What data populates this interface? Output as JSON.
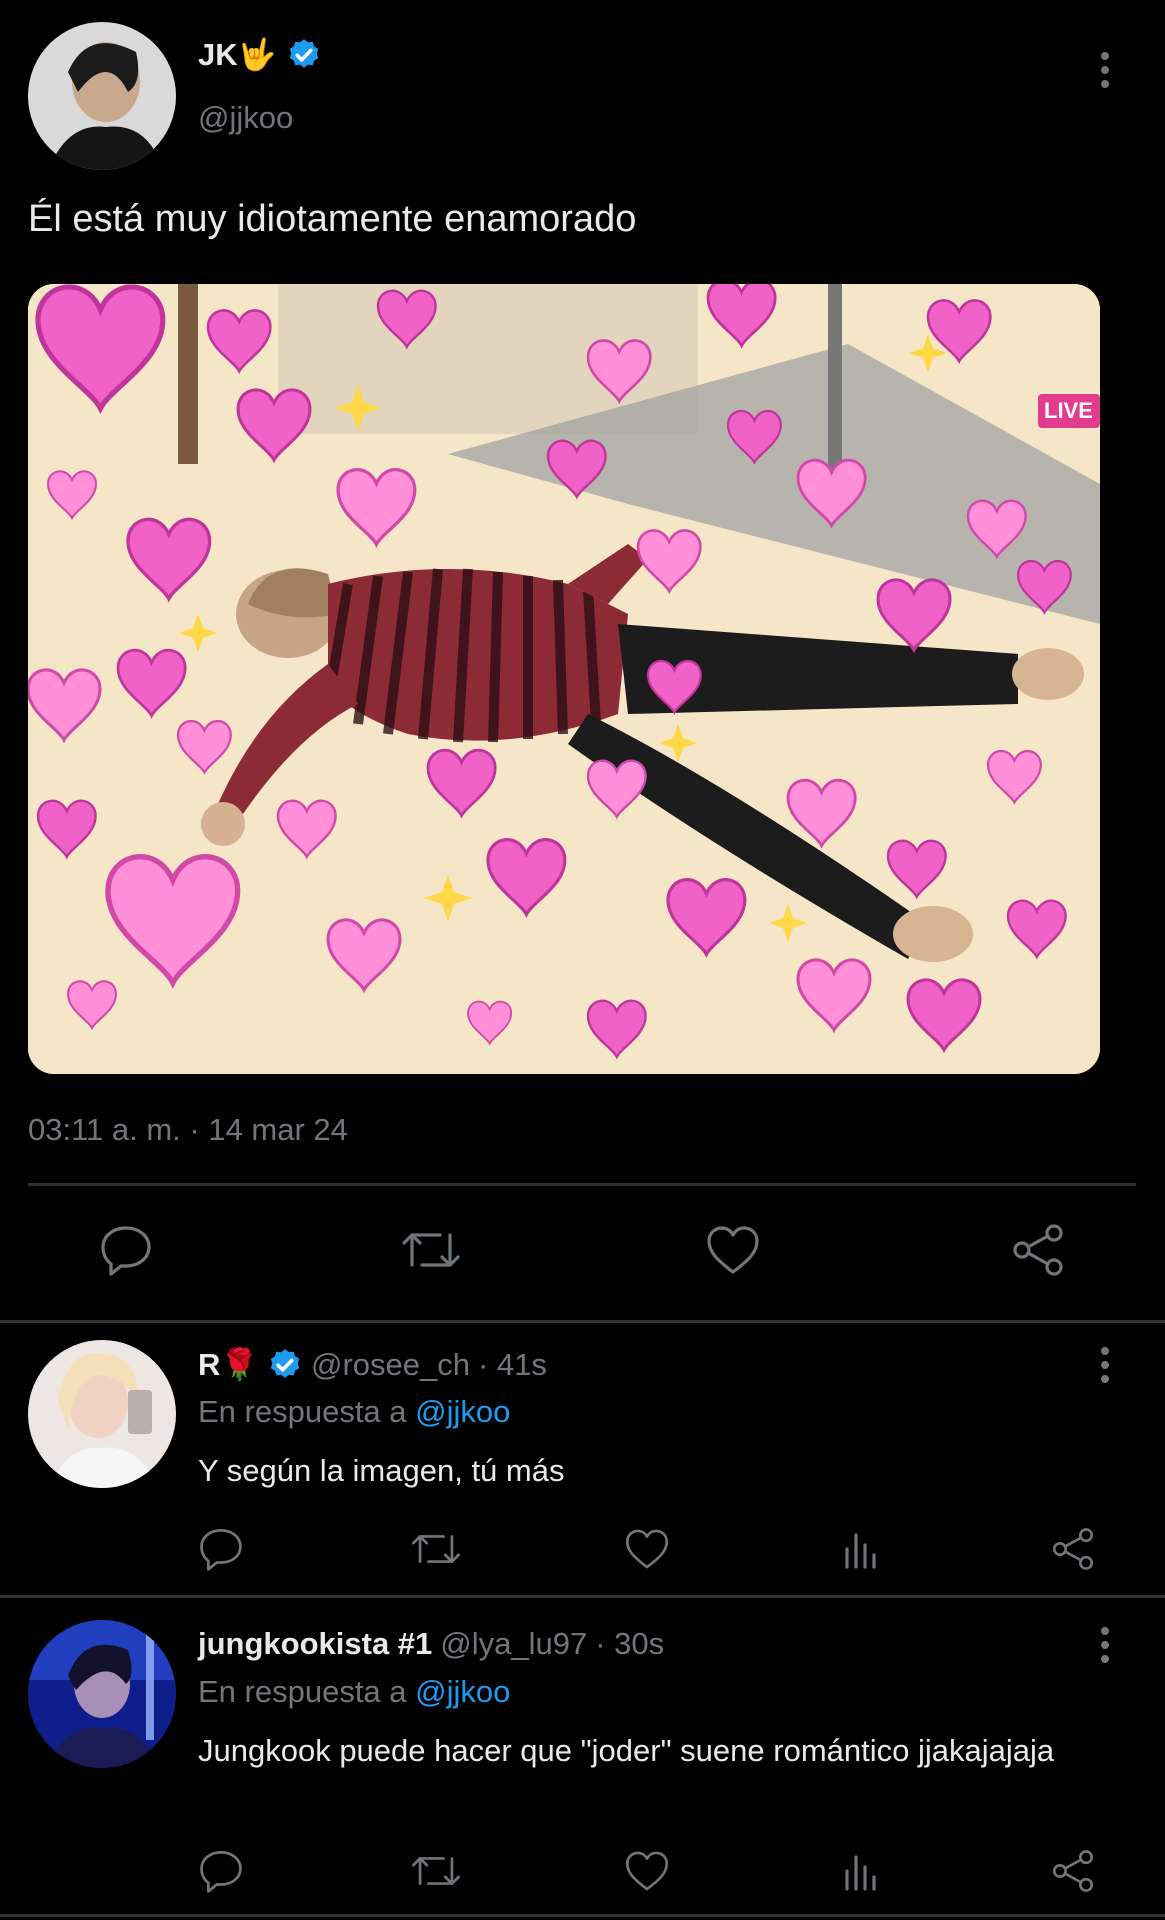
{
  "main_tweet": {
    "display_name": "JK🤟",
    "handle": "@jjkoo",
    "text": "Él está muy idiotamente enamorado",
    "timestamp": "03:11 a. m. · 14 mar 24",
    "image_caption_text": "LIVE"
  },
  "replies": [
    {
      "display_name": "R🌹",
      "handle": "@rosee_ch",
      "time": "· 41s",
      "reply_to_label": "En respuesta a",
      "reply_to_handle": "@jjkoo",
      "text": "Y según la imagen, tú más"
    },
    {
      "display_name": "jungkookista #1",
      "handle": "@lya_lu97",
      "time": "· 30s",
      "reply_to_label": "En respuesta a",
      "reply_to_handle": "@jjkoo",
      "text": "Jungkook puede hacer que \"joder\" suene romántico jjakajajaja"
    }
  ],
  "icons": {
    "verified": "verified-badge-icon",
    "more": "more-vertical-icon",
    "reply": "reply-icon",
    "retweet": "retweet-icon",
    "like": "heart-icon",
    "views": "views-icon",
    "share": "share-icon"
  },
  "colors": {
    "background": "#000000",
    "text": "#e7e9ea",
    "muted": "#71767b",
    "accent": "#1d9bf0",
    "divider": "#2f3336"
  }
}
